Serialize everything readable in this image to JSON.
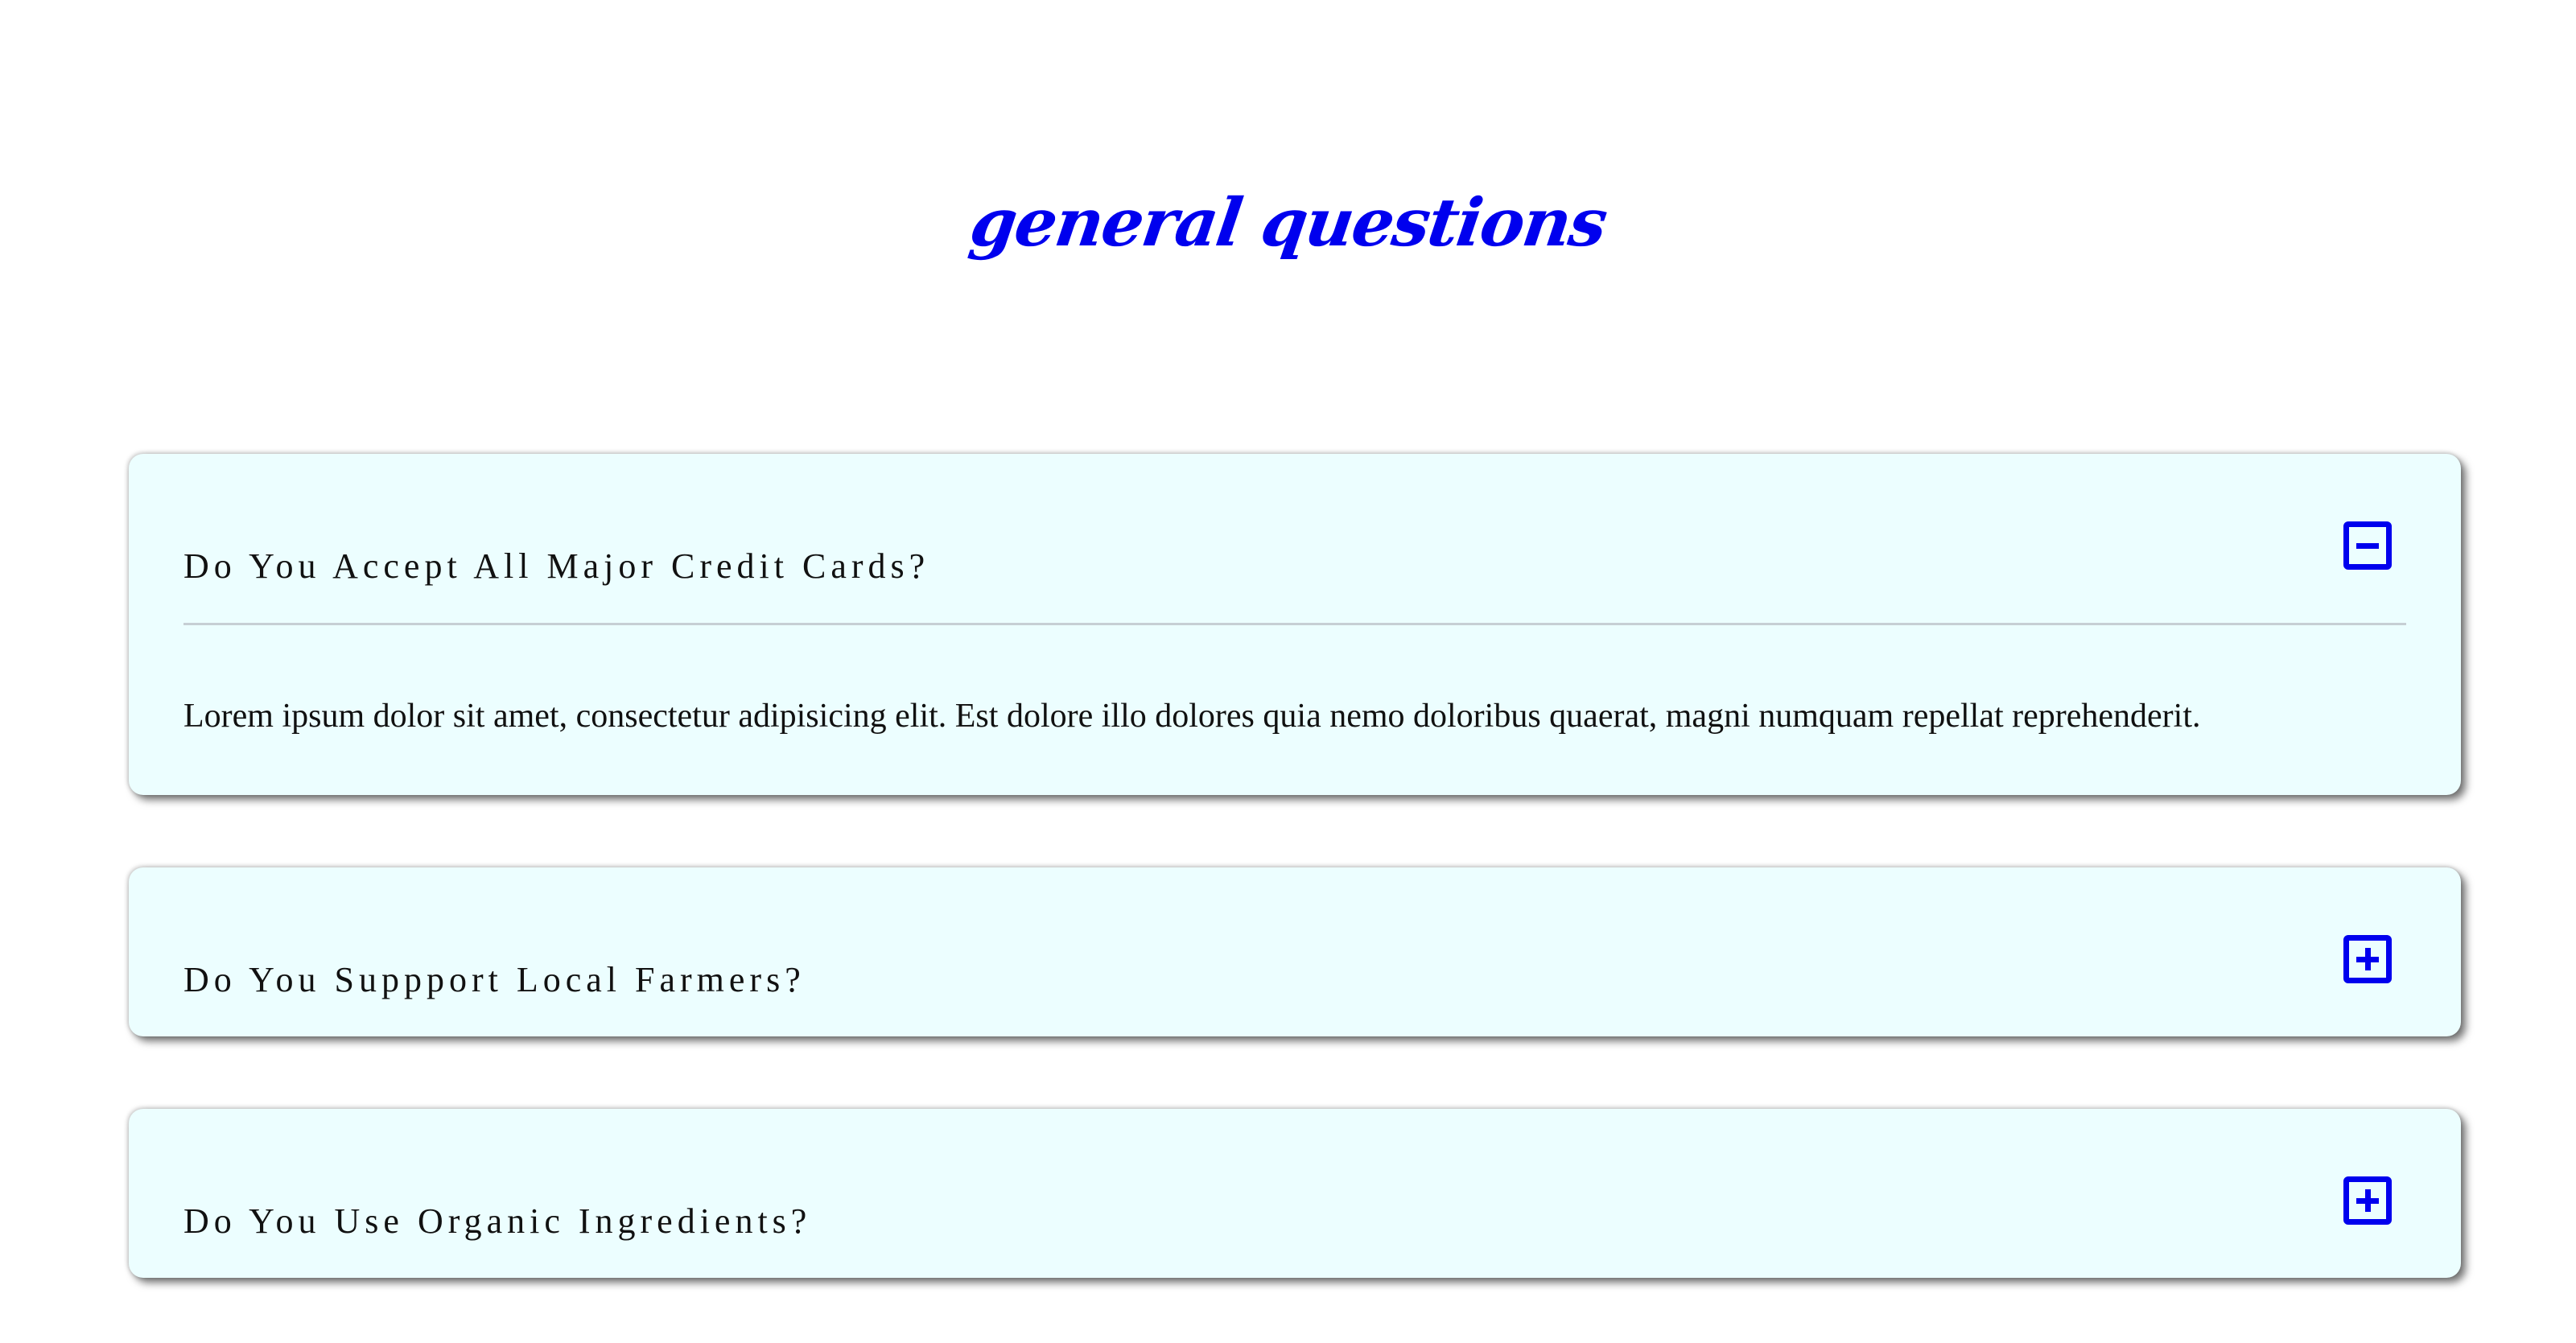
{
  "page": {
    "title": "general questions"
  },
  "colors": {
    "accent": "#0000ee",
    "card_background": "#ecfeff",
    "text": "#111111",
    "divider": "#c6cfd4"
  },
  "faq": {
    "items": [
      {
        "question": "Do You Accept All Major Credit Cards?",
        "answer": "Lorem ipsum dolor sit amet, consectetur adipisicing elit. Est dolore illo dolores quia nemo doloribus quaerat, magni numquam repellat reprehenderit.",
        "expanded": true,
        "toggle_icon": "minus-square-icon"
      },
      {
        "question": "Do You Suppport Local Farmers?",
        "expanded": false,
        "toggle_icon": "plus-square-icon"
      },
      {
        "question": "Do You Use Organic Ingredients?",
        "expanded": false,
        "toggle_icon": "plus-square-icon"
      }
    ]
  }
}
